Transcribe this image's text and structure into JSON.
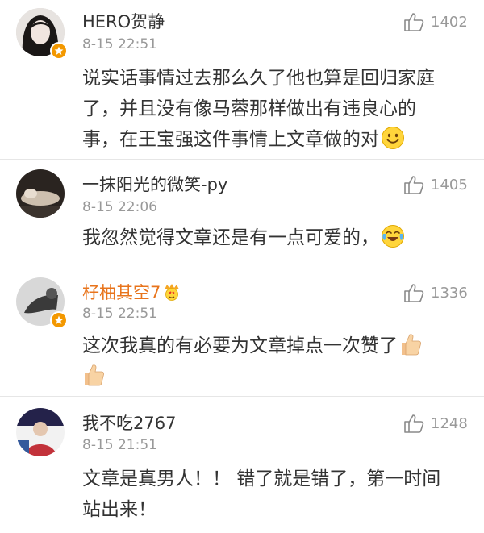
{
  "comments": [
    {
      "username": "HERO贺静",
      "time": "8-15 22:51",
      "likes": "1402",
      "text_lines": [
        "说实话事情过去那么久了他也算是回归家庭",
        "了，并且没有像马蓉那样做出有违良心的",
        "事，在王宝强这件事情上文章做的对"
      ],
      "emoji": "smile-emoji-icon",
      "verified": true
    },
    {
      "username": "一抹阳光的微笑-py",
      "time": "8-15 22:06",
      "likes": "1405",
      "text_lines": [
        "我忽然觉得文章还是有一点可爱的，"
      ],
      "emoji": "laugh-cry-emoji-icon",
      "verified": false
    },
    {
      "username": "杍柚其空7",
      "time": "8-15 22:51",
      "likes": "1336",
      "text_lines": [
        "这次我真的有必要为文章掉点一次赞了"
      ],
      "emoji": "thumbs-up-emoji-icon",
      "verified": true,
      "vip_badge": "crown-heart-eyes-icon"
    },
    {
      "username": "我不吃2767",
      "time": "8-15 21:51",
      "likes": "1248",
      "text_lines": [
        "文章是真男人！！ 错了就是错了，第一时间",
        "站出来！"
      ],
      "verified": false
    }
  ],
  "colors": {
    "username": "#333333",
    "vip_username": "#e8741c",
    "meta": "#999999",
    "verified_badge": "#f39800",
    "divider": "#e6e6e6"
  }
}
